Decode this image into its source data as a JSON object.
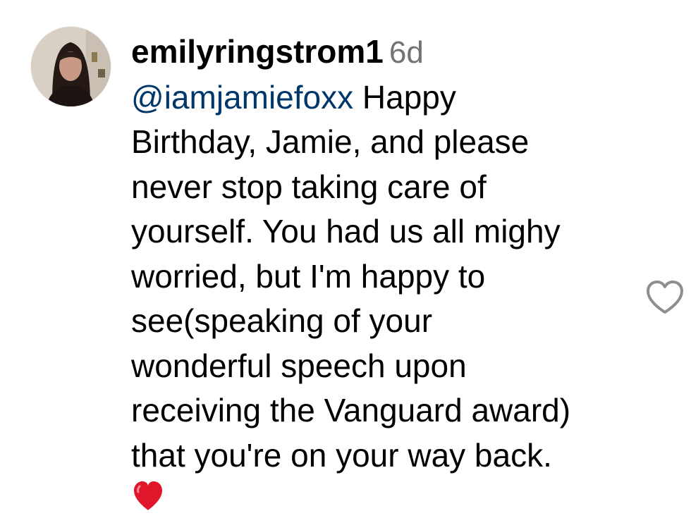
{
  "comment": {
    "username": "emilyringstrom1",
    "timestamp": "6d",
    "mention": "@iamjamiefoxx",
    "lines": [
      " Happy",
      "Birthday, Jamie, and please",
      "never stop taking care of",
      "yourself. You had us all mighy",
      "worried, but I'm happy to",
      "see(speaking of your",
      "wonderful speech upon",
      "receiving the Vanguard award)",
      "that you're on your way back."
    ],
    "emoji": "red-heart-emoji"
  },
  "actions": {
    "like_icon": "heart-outline-icon"
  },
  "colors": {
    "mention": "#00376b",
    "timestamp": "#737373",
    "like_icon": "#8e8e8e",
    "emoji_heart": "#e0162b"
  }
}
